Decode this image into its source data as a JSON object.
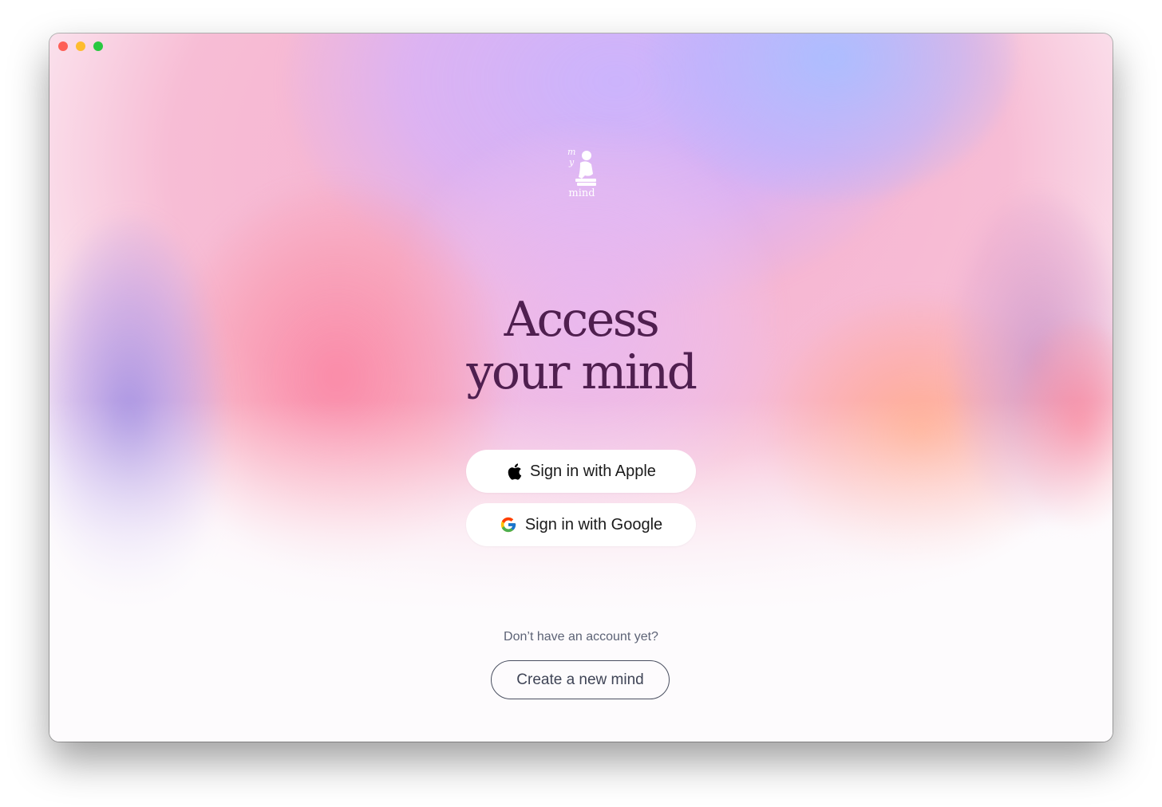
{
  "window": {
    "controls": [
      "close",
      "minimize",
      "zoom"
    ]
  },
  "logo": {
    "text": "mind",
    "icon": "thinker-on-books-icon"
  },
  "headline": {
    "line1": "Access",
    "line2": "your mind"
  },
  "auth": {
    "apple_label": "Sign in with Apple",
    "google_label": "Sign in with Google"
  },
  "signup": {
    "prompt": "Don’t have an account yet?",
    "button_label": "Create a new mind"
  },
  "colors": {
    "headline": "#4f1f4f",
    "close": "#fe5f57",
    "minimize": "#febc2e",
    "zoom": "#28c840"
  }
}
